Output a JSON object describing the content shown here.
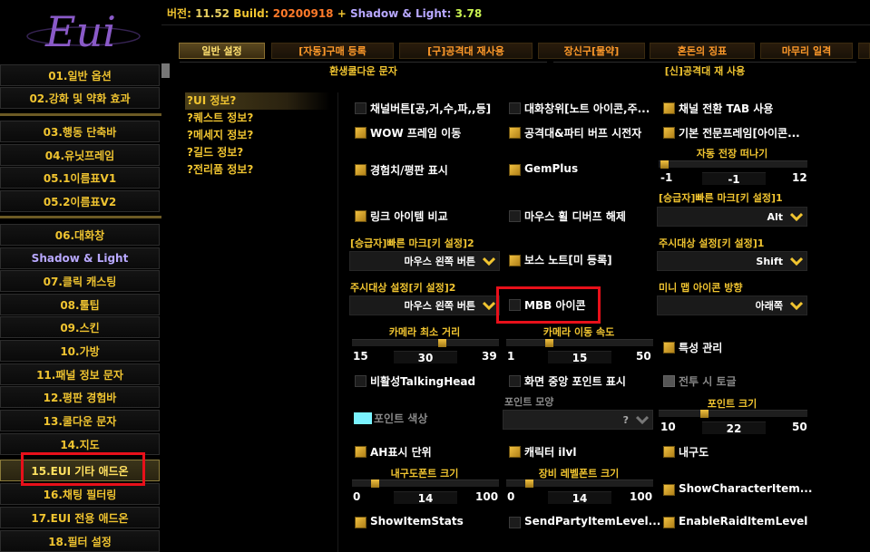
{
  "app": {
    "logo_text": "Eui",
    "version_label": "버전:",
    "version": "11.52",
    "build_label": "Build:",
    "build": "20200918",
    "plus": "+",
    "shadow_light_label": "Shadow & Light:",
    "shadow_light_version": "3.78"
  },
  "sidebar": {
    "items": [
      {
        "label": "01.일반 옵션"
      },
      {
        "label": "02.강화 및 약화 효과"
      },
      {
        "label": "03.행동 단축바"
      },
      {
        "label": "04.유닛프레임"
      },
      {
        "label": "05.1이름표V1"
      },
      {
        "label": "05.2이름표V2"
      },
      {
        "label": "06.대화창"
      },
      {
        "label": "Shadow & Light"
      },
      {
        "label": "07.클릭 캐스팅"
      },
      {
        "label": "08.툴팁"
      },
      {
        "label": "09.스킨"
      },
      {
        "label": "10.가방"
      },
      {
        "label": "11.패널 정보 문자"
      },
      {
        "label": "12.평판 경험바"
      },
      {
        "label": "13.쿨다운 문자"
      },
      {
        "label": "14.지도"
      },
      {
        "label": "15.EUI 기타 애드온"
      },
      {
        "label": "16.채팅 필터링"
      },
      {
        "label": "17.EUI 전용 애드온"
      },
      {
        "label": "18.필터 설정"
      }
    ]
  },
  "tabs": [
    {
      "label": "일반 설정"
    },
    {
      "label": "[자동]구매 등록"
    },
    {
      "label": "[구]공격대 재사용"
    },
    {
      "label": "장신구[물약]"
    },
    {
      "label": "혼돈의 징표"
    },
    {
      "label": "마무리 일격"
    }
  ],
  "subtabs": [
    {
      "label": "환생쿨다운 문자"
    },
    {
      "label": "[신]공격대 재 사용"
    }
  ],
  "info_list": [
    {
      "label": "?UI 정보?"
    },
    {
      "label": "?퀘스트 정보?"
    },
    {
      "label": "?메세지 정보?"
    },
    {
      "label": "?길드 정보?"
    },
    {
      "label": "?전리품 정보?"
    }
  ],
  "options": {
    "channel_button": "채널버튼[공,거,수,파,,등]",
    "chat_window": "대화창위[노트 아이콘,주...",
    "channel_tab": "채널 전환 TAB 사용",
    "wow_frame_move": "WOW 프레임 이동",
    "raid_party_buff": "공격대&파티 버프 시전자",
    "default_pro_frame": "기본 전문프레임[아이콘...",
    "auto_dismount_label": "자동 전장 떠나기",
    "auto_dismount": {
      "min": "-1",
      "value": "-1",
      "max": "12"
    },
    "exp_rep_display": "경험치/평판 표시",
    "gemplus": "GemPlus",
    "upgrade_mark_key1_label": "[승급자]빠른 마크[키 설정]1",
    "upgrade_mark_key1_value": "Alt",
    "link_item_compare": "링크 아이템 비교",
    "mouse_wheel_debuff": "마우스 휠 디버프 해제",
    "upgrade_mark_key2_label": "[승급자]빠른 마크[키 설정]2",
    "upgrade_mark_key2_value": "마우스 왼쪽 버튼",
    "boss_note": "보스 노트[미 등록]",
    "focus_key1_label": "주시대상 설정[키 설정]1",
    "focus_key1_value": "Shift",
    "focus_key2_label": "주시대상 설정[키 설정]2",
    "focus_key2_value": "마우스 왼쪽 버튼",
    "mbb_icon": "MBB 아이콘",
    "minimap_icon_dir_label": "미니 맵 아이콘 방향",
    "minimap_icon_dir_value": "아래쪽",
    "camera_min_dist_label": "카메라 최소 거리",
    "camera_min_dist": {
      "min": "15",
      "value": "30",
      "max": "39"
    },
    "camera_move_speed_label": "카메라 이동 속도",
    "camera_move_speed": {
      "min": "1",
      "value": "15",
      "max": "50"
    },
    "talent_manage": "특성 관리",
    "disable_talking_head": "비활성TalkingHead",
    "center_point": "화면 중앙 포인트 표시",
    "combat_toggle": "전투 시 토글",
    "point_color": "포인트 색상",
    "point_shape_label": "포인트 모양",
    "point_shape_value": "?",
    "point_size_label": "포인트 크기",
    "point_size": {
      "min": "10",
      "value": "22",
      "max": "50"
    },
    "ah_unit": "AH표시 단위",
    "char_ilvl": "캐릭터 ilvl",
    "durability": "내구도",
    "durability_font_label": "내구도폰트 크기",
    "durability_font": {
      "min": "0",
      "value": "14",
      "max": "100"
    },
    "equip_level_font_label": "장비 레벨폰트 크기",
    "equip_level_font": {
      "min": "0",
      "value": "14",
      "max": "100"
    },
    "show_char_item": "ShowCharacterItem...",
    "show_item_stats": "ShowItemStats",
    "send_party_item": "SendPartyItemLevel...",
    "enable_raid_item": "EnableRaidItemLevel"
  },
  "colors": {
    "accent_gold": "#f0c430",
    "highlight_red": "#e8101a",
    "point_color": "#7af2ff",
    "purple_text": "#b8a8ff"
  }
}
